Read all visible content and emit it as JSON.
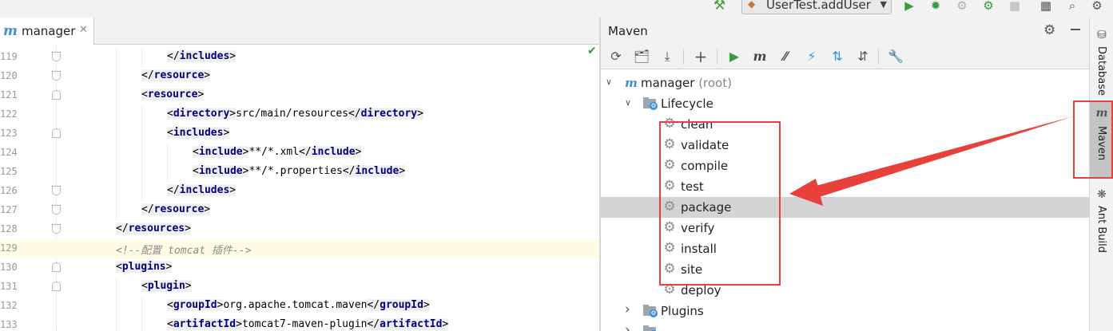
{
  "toolbar": {
    "run_config_label": "UserTest.addUser",
    "icons": [
      "hammer-icon",
      "run-icon",
      "debug-icon",
      "coverage-icon",
      "profile-icon",
      "stop-icon",
      "project-structure-icon",
      "search-everywhere-icon"
    ]
  },
  "editor": {
    "tab_label": "manager",
    "lines": [
      {
        "num": "119",
        "indent": 3,
        "parts": [
          [
            "punct",
            "</"
          ],
          [
            "tag",
            "includes"
          ],
          [
            "punct",
            ">"
          ]
        ]
      },
      {
        "num": "120",
        "indent": 2,
        "parts": [
          [
            "punct",
            "</"
          ],
          [
            "tag",
            "resource"
          ],
          [
            "punct",
            ">"
          ]
        ]
      },
      {
        "num": "121",
        "indent": 2,
        "parts": [
          [
            "punct",
            "<"
          ],
          [
            "tag",
            "resource"
          ],
          [
            "punct",
            ">"
          ]
        ]
      },
      {
        "num": "122",
        "indent": 3,
        "parts": [
          [
            "punct",
            "<"
          ],
          [
            "tag",
            "directory"
          ],
          [
            "punct",
            ">"
          ],
          [
            "txt",
            "src/main/resources"
          ],
          [
            "punct",
            "</"
          ],
          [
            "tag",
            "directory"
          ],
          [
            "punct",
            ">"
          ]
        ]
      },
      {
        "num": "123",
        "indent": 3,
        "parts": [
          [
            "punct",
            "<"
          ],
          [
            "tag",
            "includes"
          ],
          [
            "punct",
            ">"
          ]
        ]
      },
      {
        "num": "124",
        "indent": 4,
        "parts": [
          [
            "punct",
            "<"
          ],
          [
            "tag",
            "include"
          ],
          [
            "punct",
            ">"
          ],
          [
            "txt",
            "**/*.xml"
          ],
          [
            "punct",
            "</"
          ],
          [
            "tag",
            "include"
          ],
          [
            "punct",
            ">"
          ]
        ]
      },
      {
        "num": "125",
        "indent": 4,
        "parts": [
          [
            "punct",
            "<"
          ],
          [
            "tag",
            "include"
          ],
          [
            "punct",
            ">"
          ],
          [
            "txt",
            "**/*.properties"
          ],
          [
            "punct",
            "</"
          ],
          [
            "tag",
            "include"
          ],
          [
            "punct",
            ">"
          ]
        ]
      },
      {
        "num": "126",
        "indent": 3,
        "parts": [
          [
            "punct",
            "</"
          ],
          [
            "tag",
            "includes"
          ],
          [
            "punct",
            ">"
          ]
        ]
      },
      {
        "num": "127",
        "indent": 2,
        "parts": [
          [
            "punct",
            "</"
          ],
          [
            "tag",
            "resource"
          ],
          [
            "punct",
            ">"
          ]
        ]
      },
      {
        "num": "128",
        "indent": 1,
        "parts": [
          [
            "punct",
            "</"
          ],
          [
            "tag",
            "resources"
          ],
          [
            "punct",
            ">"
          ]
        ]
      },
      {
        "num": "129",
        "indent": 1,
        "parts": [
          [
            "cmt",
            "<!--配置 tomcat 插件-->"
          ]
        ]
      },
      {
        "num": "130",
        "indent": 1,
        "parts": [
          [
            "punct",
            "<"
          ],
          [
            "tag",
            "plugins"
          ],
          [
            "punct",
            ">"
          ]
        ]
      },
      {
        "num": "131",
        "indent": 2,
        "parts": [
          [
            "punct",
            "<"
          ],
          [
            "tag",
            "plugin"
          ],
          [
            "punct",
            ">"
          ]
        ]
      },
      {
        "num": "132",
        "indent": 3,
        "parts": [
          [
            "punct",
            "<"
          ],
          [
            "tag",
            "groupId"
          ],
          [
            "punct",
            ">"
          ],
          [
            "txt",
            "org.apache.tomcat.maven"
          ],
          [
            "punct",
            "</"
          ],
          [
            "tag",
            "groupId"
          ],
          [
            "punct",
            ">"
          ]
        ]
      },
      {
        "num": "133",
        "indent": 3,
        "parts": [
          [
            "punct",
            "<"
          ],
          [
            "tag",
            "artifactId"
          ],
          [
            "punct",
            ">"
          ],
          [
            "txt",
            "tomcat7-maven-plugin"
          ],
          [
            "punct",
            "</"
          ],
          [
            "tag",
            "artifactId"
          ],
          [
            "punct",
            ">"
          ]
        ]
      }
    ]
  },
  "maven": {
    "title": "Maven",
    "root": {
      "label": "manager",
      "suffix": "(root)"
    },
    "lifecycle_label": "Lifecycle",
    "phases": [
      "clean",
      "validate",
      "compile",
      "test",
      "package",
      "verify",
      "install",
      "site",
      "deploy"
    ],
    "selected_phase": "package",
    "plugins_label": "Plugins"
  },
  "right_stripe": {
    "database": "Database",
    "maven": "Maven",
    "ant_build": "Ant Build"
  }
}
